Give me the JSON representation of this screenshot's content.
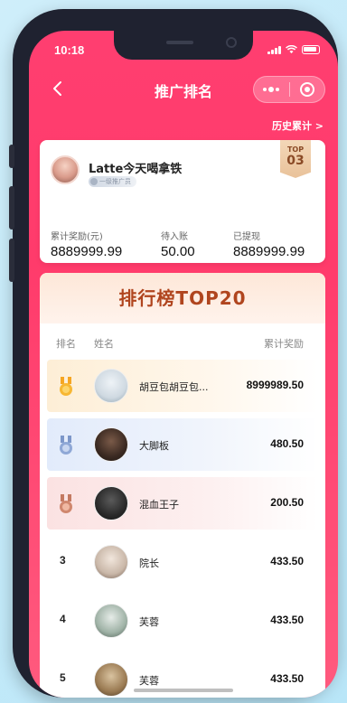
{
  "status_bar": {
    "time": "10:18"
  },
  "nav": {
    "title": "推广排名"
  },
  "history_link": "历史累计 >",
  "profile": {
    "username": "Latte今天喝拿铁",
    "tier": "一级推广员",
    "top_badge": {
      "label": "TOP",
      "rank": "03"
    },
    "stats": [
      {
        "label": "累计奖励(元)",
        "value": "8889999.99"
      },
      {
        "label": "待入账",
        "value": "50.00"
      },
      {
        "label": "已提现",
        "value": "8889999.99"
      }
    ]
  },
  "ranking": {
    "title": "排行榜TOP20",
    "columns": {
      "rank": "排名",
      "name": "姓名",
      "reward": "累计奖励"
    },
    "rows": [
      {
        "rank": "",
        "medal": "gold-medal-icon",
        "name": "胡豆包胡豆包...",
        "amount": "8999989.50"
      },
      {
        "rank": "",
        "medal": "silver-medal-icon",
        "name": "大脚板",
        "amount": "480.50"
      },
      {
        "rank": "",
        "medal": "bronze-medal-icon",
        "name": "混血王子",
        "amount": "200.50"
      },
      {
        "rank": "3",
        "medal": "",
        "name": "院长",
        "amount": "433.50"
      },
      {
        "rank": "4",
        "medal": "",
        "name": "芙蓉",
        "amount": "433.50"
      },
      {
        "rank": "5",
        "medal": "",
        "name": "芙蓉",
        "amount": "433.50"
      }
    ]
  },
  "colors": {
    "header_gradient_top": "#ff3e70",
    "rank_title": "#b0451e",
    "gold": "#f5a623",
    "silver": "#8fa8d6",
    "bronze": "#d0876e"
  }
}
